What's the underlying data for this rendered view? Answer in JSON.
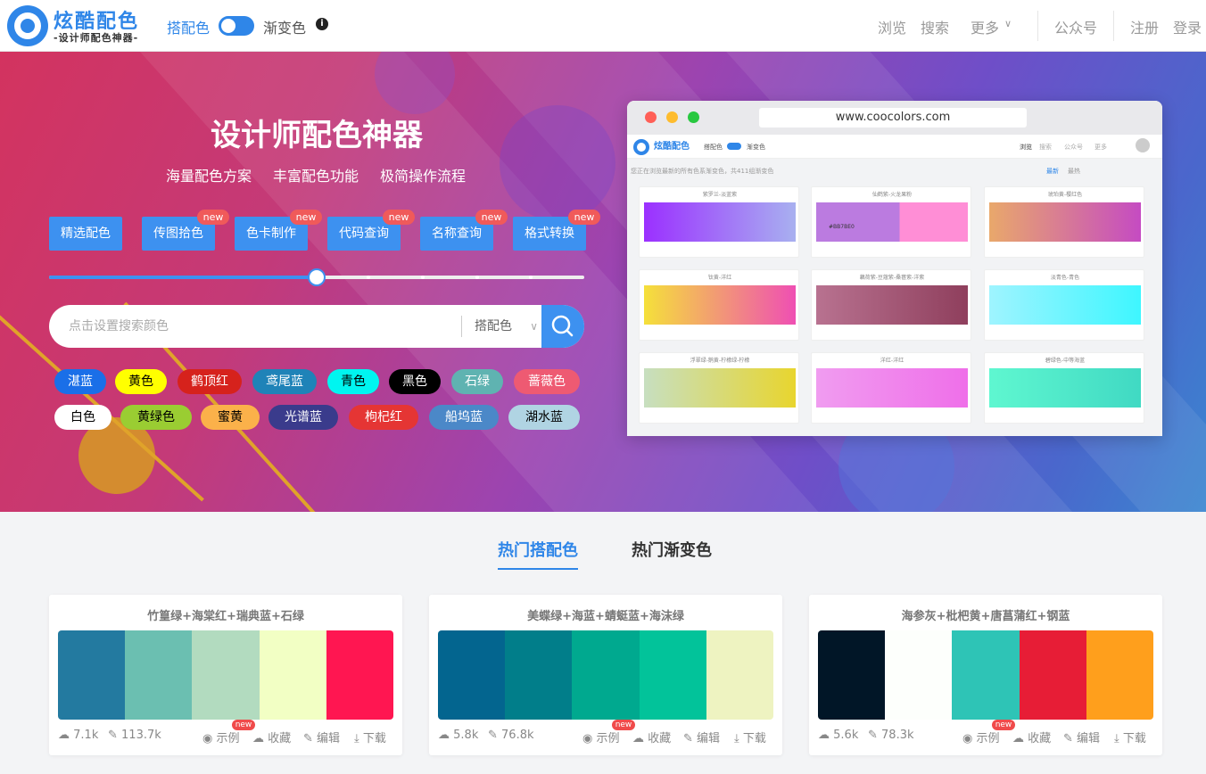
{
  "header": {
    "logo_title": "炫酷配色",
    "logo_subtitle": "-设计师配色神器-",
    "mode_left": "搭配色",
    "mode_right": "渐变色",
    "info": "i",
    "nav": [
      "浏览",
      "搜索",
      "更多"
    ],
    "nav_chevron": "∨",
    "public_account": "公众号",
    "register": "注册",
    "login": "登录"
  },
  "hero": {
    "title": "设计师配色神器",
    "subtitles": [
      "海量配色方案",
      "丰富配色功能",
      "极简操作流程"
    ],
    "features": [
      {
        "label": "精选配色",
        "new": ""
      },
      {
        "label": "传图拾色",
        "new": "new"
      },
      {
        "label": "色卡制作",
        "new": "new"
      },
      {
        "label": "代码查询",
        "new": "new"
      },
      {
        "label": "名称查询",
        "new": "new"
      },
      {
        "label": "格式转换",
        "new": "new"
      }
    ],
    "slider_value": 0.5,
    "search_placeholder": "点击设置搜索颜色",
    "search_type": "搭配色",
    "chips_row1": [
      {
        "label": "湛蓝",
        "color": "#1a6fe8",
        "text": "#ffffff"
      },
      {
        "label": "黄色",
        "color": "#ffff00",
        "text": "#000000"
      },
      {
        "label": "鹤顶红",
        "color": "#d6221c",
        "text": "#ffffff"
      },
      {
        "label": "鸢尾蓝",
        "color": "#1f83b8",
        "text": "#ffffff"
      },
      {
        "label": "青色",
        "color": "#00f5f0",
        "text": "#000000"
      },
      {
        "label": "黑色",
        "color": "#000000",
        "text": "#ffffff"
      },
      {
        "label": "石绿",
        "color": "#5fb3b1",
        "text": "#ffffff"
      },
      {
        "label": "蔷薇色",
        "color": "#ee5a72",
        "text": "#ffffff"
      }
    ],
    "chips_row2": [
      {
        "label": "白色",
        "color": "#ffffff",
        "text": "#000000"
      },
      {
        "label": "黄绿色",
        "color": "#9acd32",
        "text": "#000000"
      },
      {
        "label": "蜜黄",
        "color": "#fbb14a",
        "text": "#000000"
      },
      {
        "label": "光谱蓝",
        "color": "#3a3b8c",
        "text": "#ffffff"
      },
      {
        "label": "枸杞红",
        "color": "#e53534",
        "text": "#ffffff"
      },
      {
        "label": "船坞蓝",
        "color": "#4b88c8",
        "text": "#ffffff"
      },
      {
        "label": "湖水蓝",
        "color": "#b0d4e3",
        "text": "#000000"
      }
    ],
    "browser_url": "www.coocolors.com",
    "mini_header": {
      "logo": "炫酷配色",
      "mode_left": "搭配色",
      "mode_right": "渐变色",
      "nav": [
        "浏览",
        "搜索",
        "公众号",
        "更多"
      ]
    },
    "mini_notice": "您正在浏览最新的所有色系渐变色，共411组渐变色",
    "mini_tabs": [
      "最新",
      "最热"
    ],
    "mini_cards": [
      {
        "title": "紫罗兰-淡蓝紫",
        "g": "linear-gradient(90deg,#9b30ff,#a8b0f0)"
      },
      {
        "title": "仙鹤紫-火龙果粉",
        "g": "linear-gradient(90deg,#bb7be0 0%,#bb7be0 55%,#ff8ed6 55%,#ff8ed6 100%)",
        "code": "#BB7BE0"
      },
      {
        "title": "琥珀黄-樱红色",
        "g": "linear-gradient(90deg,#e9a86b,#c54bc2)"
      },
      {
        "title": "钛黄-洋红",
        "g": "linear-gradient(90deg,#f5e03a,#ef4fb3)"
      },
      {
        "title": "藕荷紫-豆蔻紫-桑葚紫-洋紫",
        "g": "linear-gradient(90deg,#b87290,#8f3f5d)"
      },
      {
        "title": "淡青色-青色",
        "g": "linear-gradient(90deg,#9ff4ff,#3ef6ff)"
      },
      {
        "title": "浮翠绿-鹅黄-柠檬绿-柠檬",
        "g": "linear-gradient(90deg,#c7dfc0,#e8d52e)"
      },
      {
        "title": "洋红-洋红",
        "g": "linear-gradient(90deg,#f09cf0,#ef6fe9)"
      },
      {
        "title": "碧绿色-中等海蓝",
        "g": "linear-gradient(90deg,#5ff7d0,#40d9c3)"
      }
    ]
  },
  "hot": {
    "tabs": [
      "热门搭配色",
      "热门渐变色"
    ],
    "cards": [
      {
        "title": "竹篁绿+海棠红+瑞典蓝+石绿",
        "colors": [
          "#237aa0",
          "#6bbfb1",
          "#b2dbbf",
          "#f2ffc4",
          "#ff1651"
        ],
        "likes": "7.1k",
        "views": "113.7k"
      },
      {
        "title": "美蝶绿+海蓝+蜻蜓蓝+海沫绿",
        "colors": [
          "#03658f",
          "#017e8a",
          "#00a98f",
          "#02c39a",
          "#eef3c1"
        ],
        "likes": "5.8k",
        "views": "76.8k"
      },
      {
        "title": "海参灰+枇杷黄+唐菖蒲红+钢蓝",
        "colors": [
          "#011627",
          "#fdfffc",
          "#2ec4b6",
          "#e71d36",
          "#ff9f1c"
        ],
        "likes": "5.6k",
        "views": "78.3k"
      }
    ],
    "actions": [
      "示例",
      "收藏",
      "编辑",
      "下载"
    ],
    "new_badge": "new"
  }
}
